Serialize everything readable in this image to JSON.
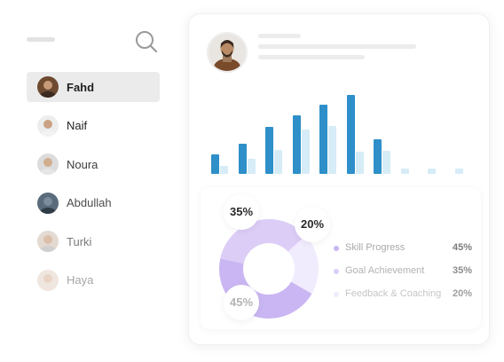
{
  "sidebar": {
    "items": [
      {
        "name": "Fahd",
        "active": true,
        "text_color": "#1f1f1f"
      },
      {
        "name": "Naif",
        "active": false,
        "text_color": "#1f1f1f"
      },
      {
        "name": "Noura",
        "active": false,
        "text_color": "#3c3c3c"
      },
      {
        "name": "Abdullah",
        "active": false,
        "text_color": "#4e4e4e"
      },
      {
        "name": "Turki",
        "active": false,
        "text_color": "#7a7a7a"
      },
      {
        "name": "Haya",
        "active": false,
        "text_color": "#a6a6a6"
      }
    ]
  },
  "icons": {
    "menu": "menu-icon",
    "search": "search-icon"
  },
  "colors": {
    "bar_dark": "#2e8fc9",
    "bar_light": "#d6ecf7",
    "skill": "#c9b6f2",
    "goal": "#dccdf7",
    "feedback": "#f1ecfd"
  },
  "chart_data": [
    {
      "type": "bar",
      "series": [
        {
          "values": [
            3.5,
            5.5,
            8.5,
            10.5,
            12.5,
            14.2,
            6.2,
            0,
            0,
            0
          ]
        },
        {
          "values": [
            1.5,
            2.8,
            4.4,
            8.0,
            8.7,
            4.0,
            4.2,
            1.0,
            1.0,
            1.0
          ]
        }
      ],
      "ylim": [
        0,
        16
      ]
    },
    {
      "type": "pie",
      "labels": [
        "Skill Progress",
        "Goal Achievement",
        "Feedback & Coaching"
      ],
      "values": [
        45,
        35,
        20
      ],
      "value_labels": [
        "45%",
        "35%",
        "20%"
      ]
    }
  ]
}
